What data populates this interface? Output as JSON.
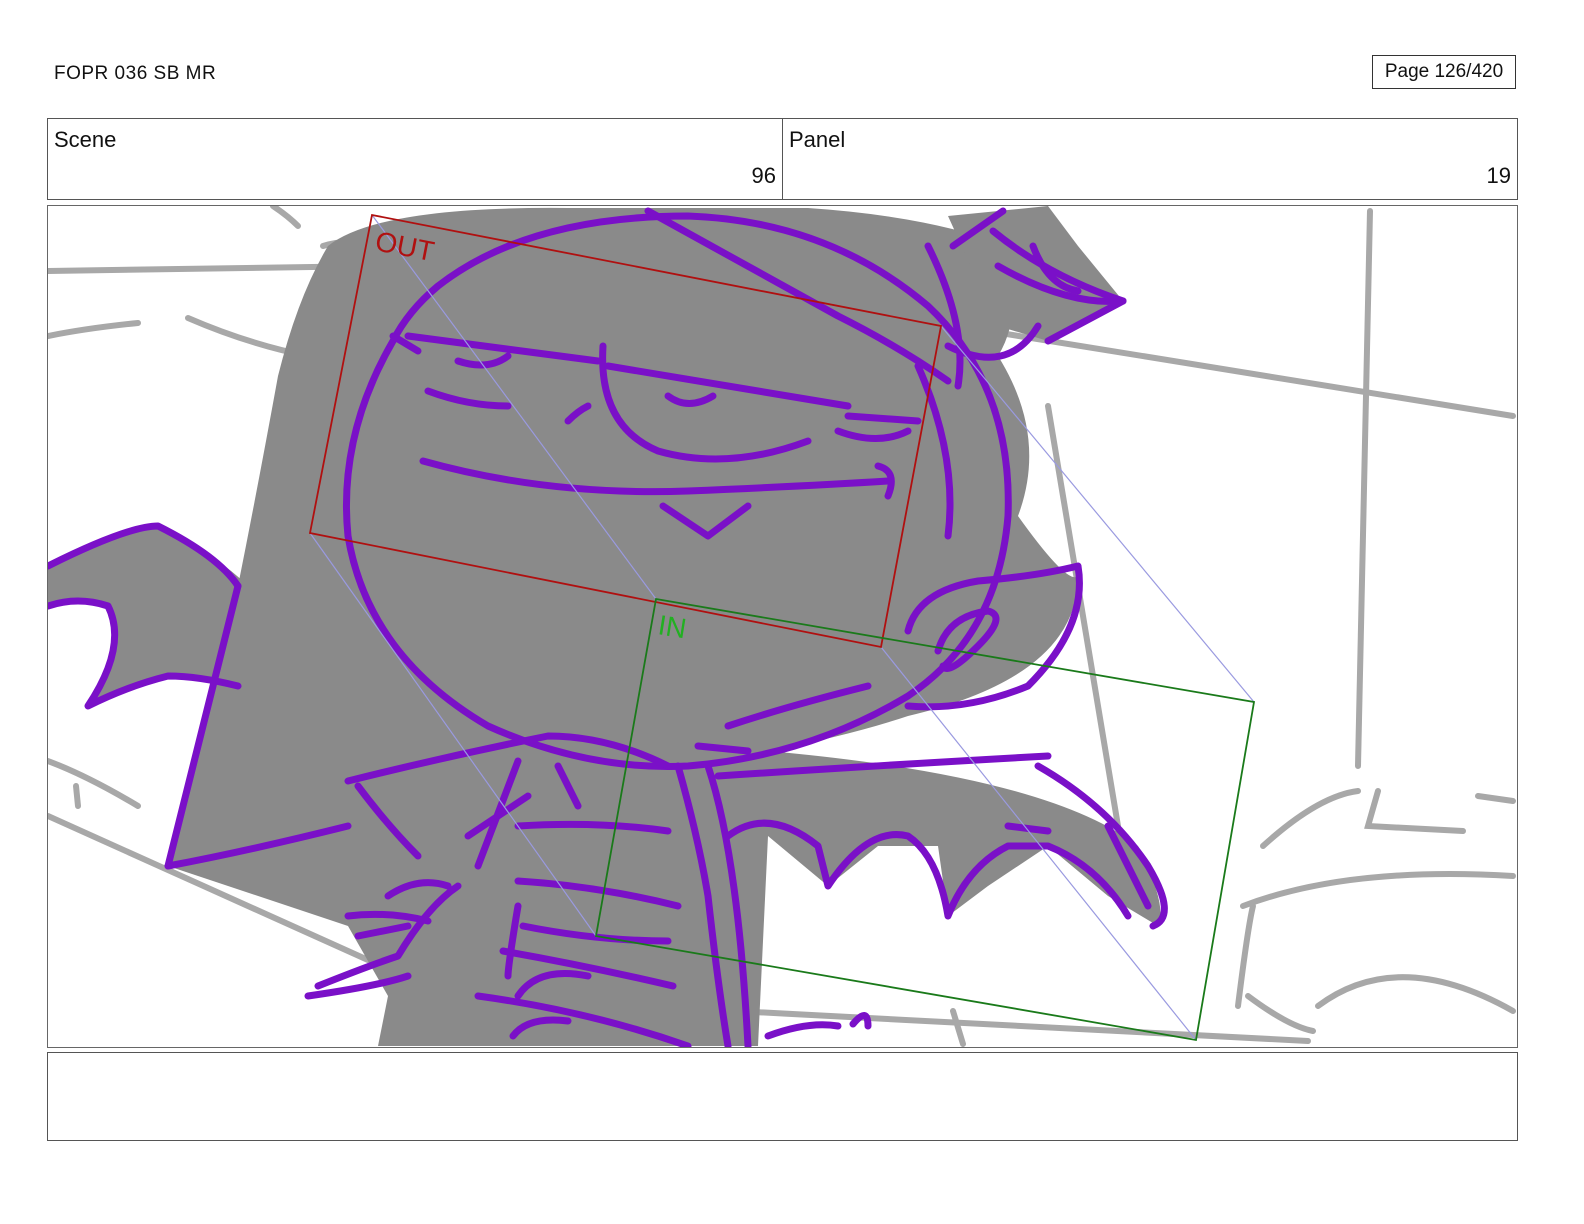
{
  "header": {
    "doc_title": "FOPR 036 SB MR",
    "page_label": "Page 126/420"
  },
  "info": {
    "scene_label": "Scene",
    "scene_value": "96",
    "panel_label": "Panel",
    "panel_value": "19"
  },
  "camera": {
    "out_label": "OUT",
    "in_label": "IN",
    "out_color": "#b01010",
    "in_color": "#1a7a1a",
    "in_text_color": "#22b022",
    "path_color": "#9a9ae0"
  },
  "drawing": {
    "line_color": "#7a10c8",
    "fill_color": "#8a8a8a",
    "bg_line_color": "#a8a8a8"
  },
  "notes": {
    "text": ""
  }
}
